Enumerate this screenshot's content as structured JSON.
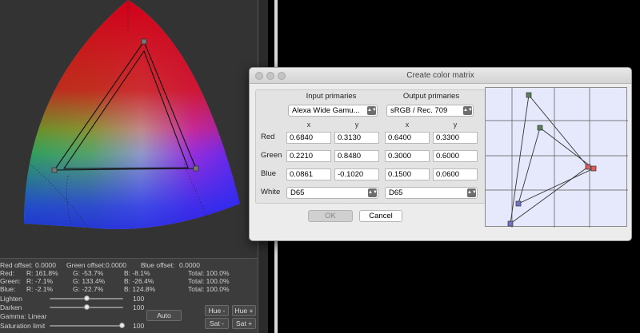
{
  "editor": {
    "offsets": {
      "red_label": "Red offset:",
      "red_value": "0.0000",
      "green_label": "Green offset:",
      "green_value": "0.0000",
      "blue_label": "Blue offset:",
      "blue_value": "0.0000"
    },
    "matrix_rows": [
      {
        "label": "Red:",
        "r": "R: 161.8%",
        "g": "G: -53.7%",
        "b": "B: -8.1%",
        "total": "Total: 100.0%"
      },
      {
        "label": "Green:",
        "r": "R: -7.1%",
        "g": "G: 133.4%",
        "b": "B: -26.4%",
        "total": "Total: 100.0%"
      },
      {
        "label": "Blue:",
        "r": "R: -2.1%",
        "g": "G: -22.7%",
        "b": "B: 124.8%",
        "total": "Total: 100.0%"
      }
    ],
    "sliders": [
      {
        "label": "Lighten",
        "value": "100",
        "level": 0.5
      },
      {
        "label": "Darken",
        "value": "100",
        "level": 0.5
      },
      {
        "label": "Saturation limit",
        "value": "100",
        "level": 0.98
      }
    ],
    "gamma_label": "Gamma: Linear",
    "auto_label": "Auto",
    "hue_minus": "Hue -",
    "hue_plus": "Hue +",
    "sat_minus": "Sat -",
    "sat_plus": "Sat +",
    "accent_colors": {
      "panel": "#3a3a3a",
      "text": "#cfcfcf"
    }
  },
  "dialog": {
    "title": "Create color matrix",
    "input_header": "Input primaries",
    "output_header": "Output primaries",
    "input_preset": "Alexa Wide Gamu...",
    "output_preset": "sRGB / Rec. 709",
    "x_label": "x",
    "y_label": "y",
    "rows": [
      {
        "label": "Red",
        "in_x": "0.6840",
        "in_y": "0.3130",
        "out_x": "0.6400",
        "out_y": "0.3300"
      },
      {
        "label": "Green",
        "in_x": "0.2210",
        "in_y": "0.8480",
        "out_x": "0.3000",
        "out_y": "0.6000"
      },
      {
        "label": "Blue",
        "in_x": "0.0861",
        "in_y": "-0.1020",
        "out_x": "0.1500",
        "out_y": "0.0600"
      }
    ],
    "white_label": "White",
    "input_white": "D65",
    "output_white": "D65",
    "ok_label": "OK",
    "cancel_label": "Cancel",
    "dropdown_icon": "up-down-chevron-icon",
    "marker_colors": {
      "red": "#e05b5b",
      "green": "#5a7f5a",
      "blue": "#6f73c8"
    }
  }
}
